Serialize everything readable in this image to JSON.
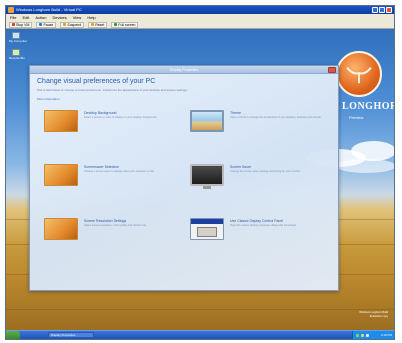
{
  "vm_window": {
    "title": "Windows Longhorn Build - Virtual PC",
    "menu": [
      "File",
      "Edit",
      "Action",
      "Devices",
      "View",
      "Help"
    ],
    "toolbar": [
      {
        "label": "Stop VM",
        "color": "#d23b2b"
      },
      {
        "label": "Pause",
        "color": "#2e72d2"
      },
      {
        "label": "Suspend",
        "color": "#e0a228"
      },
      {
        "label": "Reset",
        "color": "#e0a228"
      },
      {
        "label": "Full screen",
        "color": "#2e9a3a"
      }
    ]
  },
  "desktop": {
    "icons": [
      {
        "label": "My Computer"
      },
      {
        "label": "Recycle Bin"
      }
    ],
    "brand": {
      "logo_text": "LONGHORN",
      "tagline": "Preview"
    }
  },
  "dialog": {
    "title": "Display Properties",
    "heading": "Change visual preferences of your PC",
    "intro": "Pick a task below or choose a control panel icon. Customize the appearance of your desktop and screen settings.",
    "more_link": "More information",
    "options": [
      {
        "title": "Desktop Background",
        "desc": "Select a picture or color to display on your desktop background."
      },
      {
        "title": "Theme",
        "desc": "Apply a theme to change the overall look of your desktop, windows and sounds."
      },
      {
        "title": "Screensaver Selection",
        "desc": "Choose a screen saver to display when your computer is idle."
      },
      {
        "title": "Screen Saver",
        "desc": "Change the screen saver settings and timing for your monitor."
      },
      {
        "title": "Screen Resolution Settings",
        "desc": "Adjust screen resolution, color quality and refresh rate."
      },
      {
        "title": "Use Classic Display Control Panel",
        "desc": "Open the classic display properties dialog with all settings."
      }
    ]
  },
  "taskbar": {
    "task": "Display Properties",
    "clock": "4:18 PM"
  },
  "watermark": [
    "Windows Longhorn Build",
    "Evaluation copy"
  ]
}
